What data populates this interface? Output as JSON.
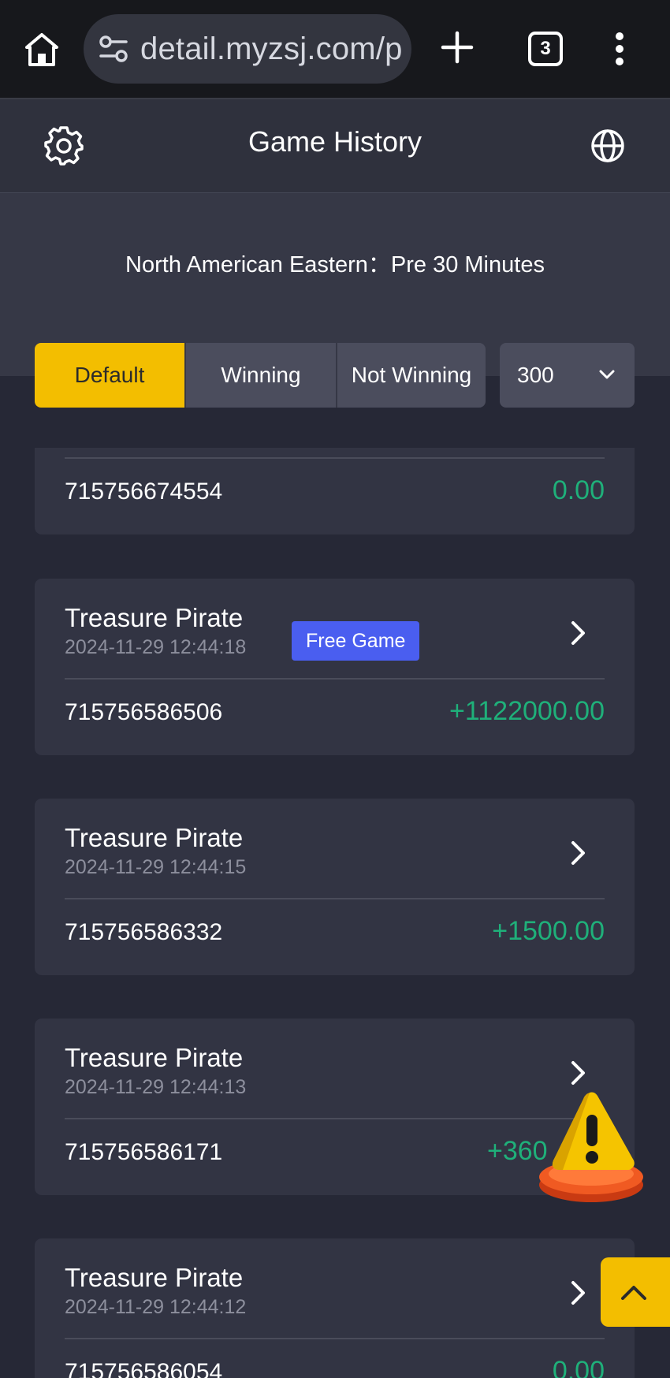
{
  "browser": {
    "url": "detail.myzsj.com/p",
    "tab_count": "3"
  },
  "header": {
    "title": "Game History"
  },
  "timezone_label": "North American Eastern：Pre 30 Minutes",
  "filter": {
    "segments": [
      "Default",
      "Winning",
      "Not Winning"
    ],
    "active": "Default",
    "count_select": "300"
  },
  "records": [
    {
      "id": "715756674554",
      "amount": "0.00"
    },
    {
      "name": "Treasure Pirate",
      "time": "2024-11-29 12:44:18",
      "badge": "Free Game",
      "id": "715756586506",
      "amount": "+1122000.00"
    },
    {
      "name": "Treasure Pirate",
      "time": "2024-11-29 12:44:15",
      "id": "715756586332",
      "amount": "+1500.00"
    },
    {
      "name": "Treasure Pirate",
      "time": "2024-11-29 12:44:13",
      "id": "715756586171",
      "amount": "+360"
    },
    {
      "name": "Treasure Pirate",
      "time": "2024-11-29 12:44:12",
      "id": "715756586054",
      "amount": "0.00"
    }
  ],
  "colors": {
    "accent": "#f3be00",
    "positive": "#1fb07a",
    "badge": "#4a5ef0"
  }
}
